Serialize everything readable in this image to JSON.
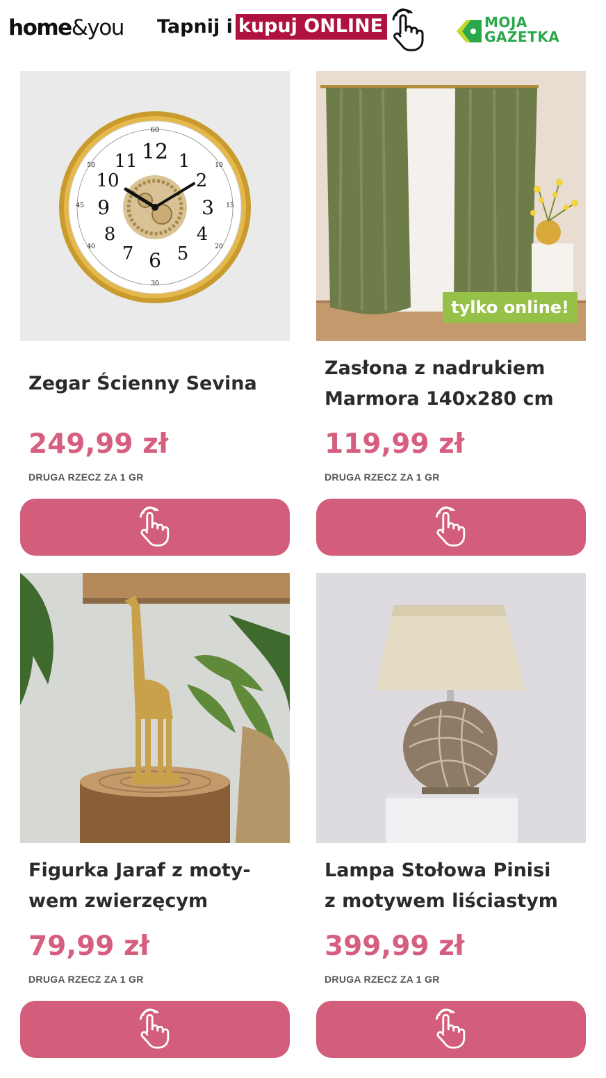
{
  "header": {
    "brand_home": "home",
    "brand_you": "&you",
    "tapnij_prefix": "Tapnij i",
    "tapnij_highlight": "kupuj ONLINE",
    "moja_line1": "MOJA",
    "moja_line2": "GAZETKA"
  },
  "colors": {
    "accent_pink": "#d35e7b",
    "price_pink": "#d65f80",
    "highlight_red": "#b0123f",
    "badge_green": "#95c149",
    "moja_green": "#2aa84a"
  },
  "products": [
    {
      "title_line1": "Zegar Ścienny Sevina",
      "title_line2": "",
      "price": "249,99 zł",
      "promo": "DRUGA RZECZ ZA 1 GR",
      "image_icon": "wall-clock-image",
      "button_icon": "tap-hand-icon"
    },
    {
      "title_line1": "Zasłona z nadrukiem",
      "title_line2": "Marmora 140x280 cm",
      "price": "119,99 zł",
      "promo": "DRUGA RZECZ ZA 1 GR",
      "badge": "tylko online!",
      "image_icon": "curtain-image",
      "button_icon": "tap-hand-icon"
    },
    {
      "title_line1": "Figurka Jaraf z moty-",
      "title_line2": "wem zwierzęcym",
      "price": "79,99 zł",
      "promo": "DRUGA RZECZ ZA 1 GR",
      "image_icon": "giraffe-figurine-image",
      "button_icon": "tap-hand-icon"
    },
    {
      "title_line1": "Lampa Stołowa Pinisi",
      "title_line2": "z motywem liściastym",
      "price": "399,99 zł",
      "promo": "DRUGA RZECZ ZA 1 GR",
      "image_icon": "table-lamp-image",
      "button_icon": "tap-hand-icon"
    }
  ]
}
